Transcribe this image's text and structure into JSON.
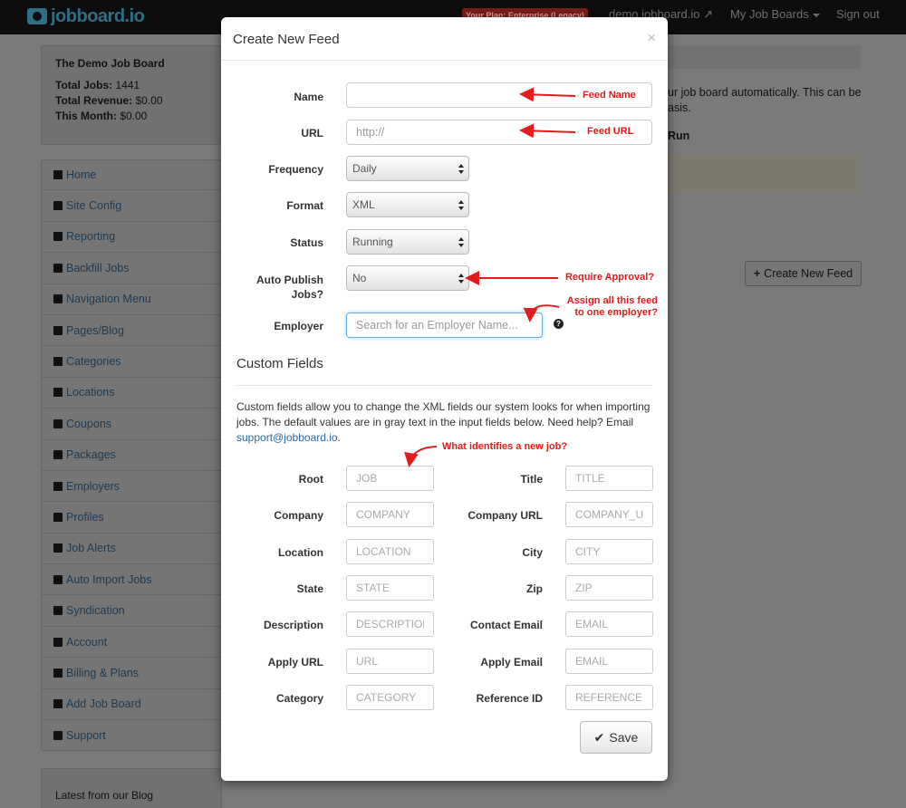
{
  "topbar": {
    "logo": "jobboard.io",
    "plan_badge": "Your Plan: Enterprise (Legacy)",
    "site_link": "demo.jobboard.io",
    "boards_menu": "My Job Boards",
    "signout": "Sign out"
  },
  "board": {
    "title": "The Demo Job Board",
    "stats": [
      {
        "label": "Total Jobs:",
        "value": "1441"
      },
      {
        "label": "Total Revenue:",
        "value": "$0.00"
      },
      {
        "label": "This Month:",
        "value": "$0.00"
      }
    ]
  },
  "sidebar": {
    "items": [
      {
        "label": "Home",
        "icon": "home-icon"
      },
      {
        "label": "Site Config",
        "icon": "gear-icon"
      },
      {
        "label": "Reporting",
        "icon": "bar-chart-icon"
      },
      {
        "label": "Backfill Jobs",
        "icon": "briefcase-icon"
      },
      {
        "label": "Navigation Menu",
        "icon": "menu-icon"
      },
      {
        "label": "Pages/Blog",
        "icon": "file-icon"
      },
      {
        "label": "Categories",
        "icon": "list-icon"
      },
      {
        "label": "Locations",
        "icon": "globe-icon"
      },
      {
        "label": "Coupons",
        "icon": "cart-icon"
      },
      {
        "label": "Packages",
        "icon": "gift-icon"
      },
      {
        "label": "Employers",
        "icon": "building-icon"
      },
      {
        "label": "Profiles",
        "icon": "users-icon"
      },
      {
        "label": "Job Alerts",
        "icon": "warning-icon"
      },
      {
        "label": "Auto Import Jobs",
        "icon": "import-icon"
      },
      {
        "label": "Syndication",
        "icon": "syndication-icon"
      },
      {
        "label": "Account",
        "icon": "user-icon"
      },
      {
        "label": "Billing & Plans",
        "icon": "credit-card-icon"
      },
      {
        "label": "Add Job Board",
        "icon": "plus-icon"
      },
      {
        "label": "Support",
        "icon": "question-icon"
      }
    ]
  },
  "blog": {
    "title": "Latest from our Blog"
  },
  "background": {
    "text": "ur job board automatically. This can be\nasis.",
    "run_header": "Run",
    "create_button": "Create New Feed"
  },
  "modal": {
    "title": "Create New Feed",
    "close": "×",
    "fields": {
      "name": {
        "label": "Name",
        "value": ""
      },
      "url": {
        "label": "URL",
        "placeholder": "http://"
      },
      "frequency": {
        "label": "Frequency",
        "value": "Daily"
      },
      "format": {
        "label": "Format",
        "value": "XML"
      },
      "status": {
        "label": "Status",
        "value": "Running"
      },
      "auto_publish": {
        "label_line1": "Auto Publish",
        "label_line2": "Jobs?",
        "value": "No"
      },
      "employer": {
        "label": "Employer",
        "placeholder": "Search for an Employer Name..."
      }
    },
    "custom": {
      "title": "Custom Fields",
      "desc": "Custom fields allow you to change the XML fields our system looks for when importing jobs. The default values are in gray text in the input fields below. Need help? Email ",
      "email": "support@jobboard.io",
      "desc_end": ".",
      "left": [
        {
          "label": "Root",
          "placeholder": "JOB"
        },
        {
          "label": "Company",
          "placeholder": "COMPANY"
        },
        {
          "label": "Location",
          "placeholder": "LOCATION"
        },
        {
          "label": "State",
          "placeholder": "STATE"
        },
        {
          "label": "Description",
          "placeholder": "DESCRIPTION"
        },
        {
          "label": "Apply URL",
          "placeholder": "URL"
        },
        {
          "label": "Category",
          "placeholder": "CATEGORY"
        }
      ],
      "right": [
        {
          "label": "Title",
          "placeholder": "TITLE"
        },
        {
          "label": "Company URL",
          "placeholder": "COMPANY_URL"
        },
        {
          "label": "City",
          "placeholder": "CITY"
        },
        {
          "label": "Zip",
          "placeholder": "ZIP"
        },
        {
          "label": "Contact Email",
          "placeholder": "EMAIL"
        },
        {
          "label": "Apply Email",
          "placeholder": "EMAIL"
        },
        {
          "label": "Reference ID",
          "placeholder": "REFERENCE"
        }
      ]
    },
    "save_label": "Save"
  },
  "annotations": {
    "feed_name": "Feed Name",
    "feed_url": "Feed URL",
    "require_approval": "Require Approval?",
    "assign_line1": "Assign all this feed",
    "assign_line2": "to one employer?",
    "identify": "What identifies a new job?",
    "color": "#e21b1b"
  }
}
